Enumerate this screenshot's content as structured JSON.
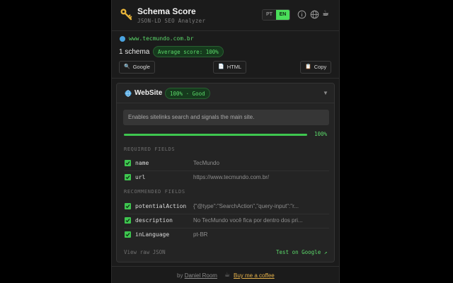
{
  "header": {
    "title": "Schema Score",
    "subtitle": "JSON-LD SEO Analyzer",
    "lang_options": [
      "PT",
      "EN"
    ],
    "active_lang": "EN"
  },
  "summary": {
    "url": "www.tecmundo.com.br",
    "schema_count": "1 schema",
    "average_badge": "Average score: 100%",
    "buttons": {
      "google": "Google",
      "html": "HTML",
      "copy": "Copy"
    }
  },
  "card": {
    "title": "WebSite",
    "badge": "100% · Good",
    "description": "Enables sitelinks search and signals the main site.",
    "progress_percent": 100,
    "progress_label": "100%",
    "required_label": "REQUIRED FIELDS",
    "required_fields": [
      {
        "name": "name",
        "value": "TecMundo"
      },
      {
        "name": "url",
        "value": "https://www.tecmundo.com.br/"
      }
    ],
    "recommended_label": "RECOMMENDED FIELDS",
    "recommended_fields": [
      {
        "name": "potentialAction",
        "value": "{\"@type\":\"SearchAction\",\"query-input\":\"r..."
      },
      {
        "name": "description",
        "value": "No TecMundo você fica por dentro dos pri..."
      },
      {
        "name": "inLanguage",
        "value": "pt-BR"
      }
    ],
    "view_raw": "View raw JSON",
    "test_google": "Test on Google ↗"
  },
  "footer": {
    "by": "by",
    "author": "Daniel Room",
    "coffee": "Buy me a coffee"
  },
  "colors": {
    "accent": "#3ec64f",
    "accent_text": "#5bd96a",
    "link_gold": "#e3b04b",
    "panel_bg": "#1b1b1b"
  }
}
